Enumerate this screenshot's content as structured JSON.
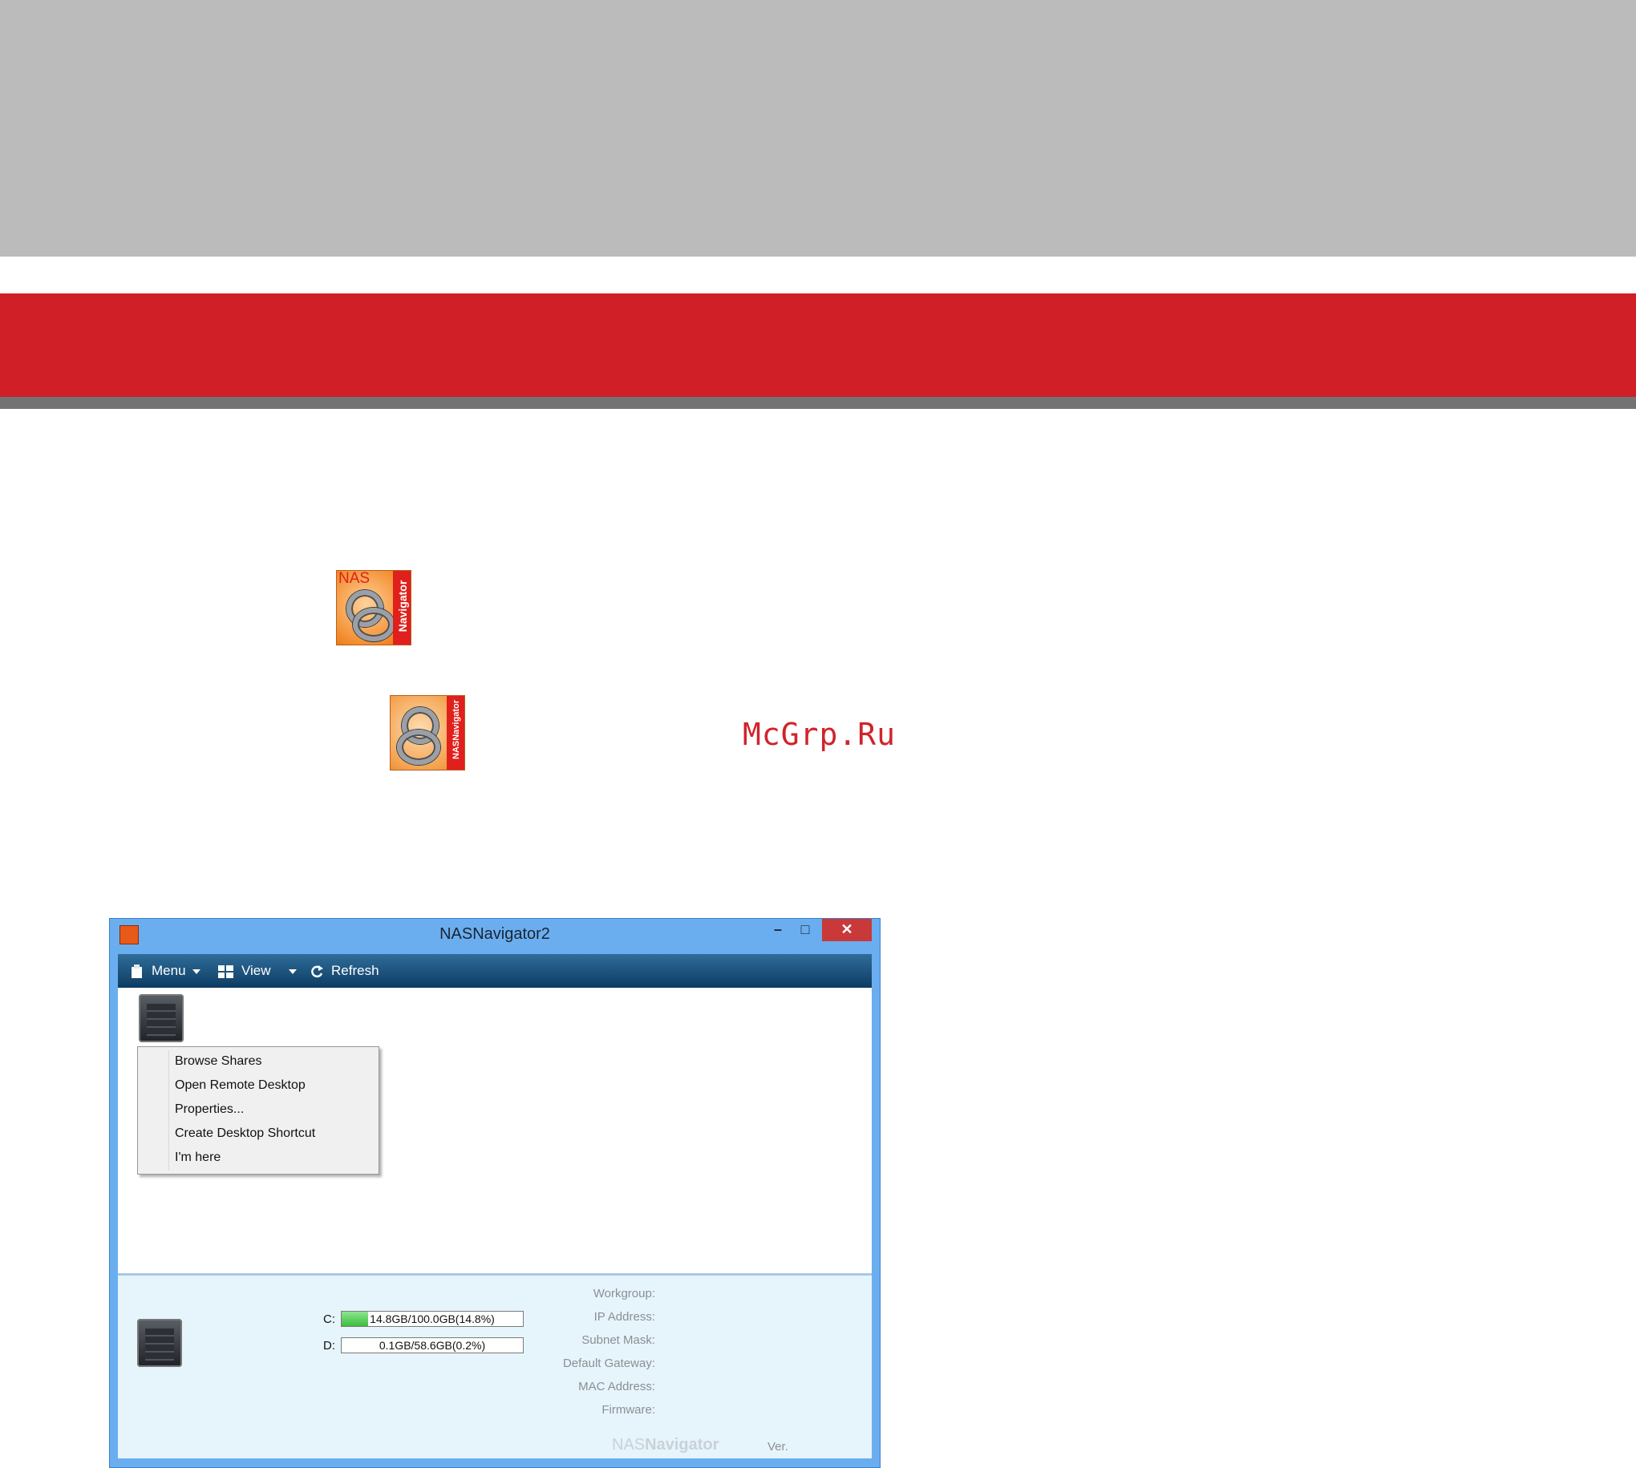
{
  "page": {
    "watermark": "McGrp.Ru",
    "colors": {
      "header_gray": "#bbbbbb",
      "header_red": "#d01f26",
      "header_dark": "#737373"
    }
  },
  "icons": {
    "nas_navigator_icon_1": {
      "name": "nas-navigator-app-icon",
      "corner_text": "NAS",
      "side_text": "Navigator"
    },
    "nas_navigator_icon_2": {
      "name": "nas-navigator2-app-icon",
      "side_text": "NASNavigator"
    }
  },
  "window": {
    "title": "NASNavigator2",
    "controls": {
      "minimize": "–",
      "maximize": "□",
      "close": "✕"
    },
    "toolbar": {
      "menu_label": "Menu",
      "view_label": "View",
      "refresh_label": "Refresh"
    },
    "context_menu": {
      "items": [
        "Browse Shares",
        "Open Remote Desktop",
        "Properties...",
        "Create Desktop Shortcut",
        "I'm here"
      ]
    },
    "drives": [
      {
        "letter": "C:",
        "text": "14.8GB/100.0GB(14.8%)",
        "used_fraction": 0.148
      },
      {
        "letter": "D:",
        "text": "0.1GB/58.6GB(0.2%)",
        "used_fraction": 0.002
      }
    ],
    "properties": [
      "Workgroup:",
      "IP Address:",
      "Subnet Mask:",
      "Default Gateway:",
      "MAC Address:",
      "Firmware:"
    ],
    "brand": {
      "part1": "NAS",
      "part2": "Navigator"
    },
    "version_label": "Ver."
  }
}
